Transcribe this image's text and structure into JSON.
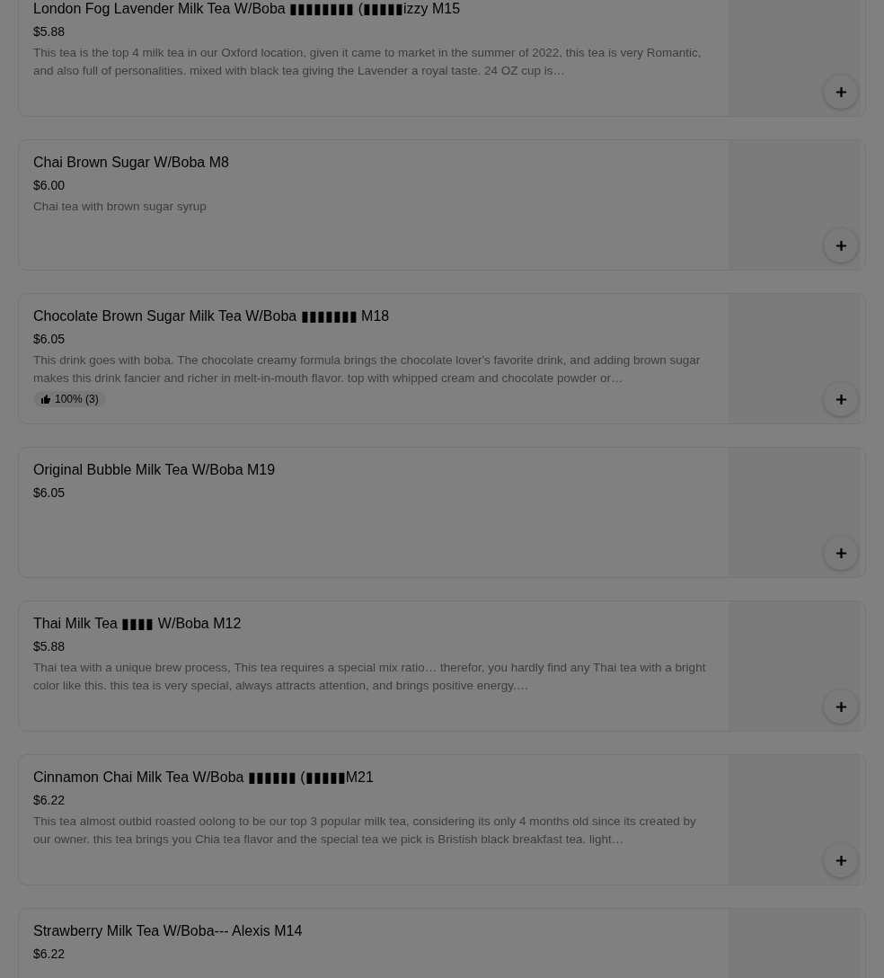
{
  "menu_items": [
    {
      "title": "London Fog Lavender Milk Tea W/Boba ▮▮▮▮▮▮▮▮ (▮▮▮▮▮izzy M15",
      "price": "$5.88",
      "description": "This tea is the top 4 milk tea in our Oxford location, given it came to market in the summer of 2022, this tea is very Romantic, and also full of personalities. mixed with black tea giving the Lavender a royal taste. 24 OZ cup is…"
    },
    {
      "title": "Chai Brown Sugar W/Boba M8",
      "price": "$6.00",
      "description": "Chai tea with brown sugar syrup"
    },
    {
      "title": "Chocolate Brown Sugar Milk Tea W/Boba ▮▮▮▮▮▮▮ M18",
      "price": "$6.05",
      "description": "This drink goes with boba. The chocolate creamy formula brings the chocolate lover's favorite drink, and adding brown sugar makes this drink fancier and richer in melt-in-mouth flavor. top with whipped cream and chocolate powder or…",
      "rating": "100% (3)"
    },
    {
      "title": "Original Bubble Milk Tea W/Boba M19",
      "price": "$6.05"
    },
    {
      "title": "Thai Milk Tea ▮▮▮▮ W/Boba M12",
      "price": "$5.88",
      "description": "Thai tea with a unique brew process, This tea requires a special mix ratio… therefor, you hardly find any Thai tea with a bright color like this. this tea is very special, always attracts attention, and brings positive energy.…"
    },
    {
      "title": "Cinnamon Chai Milk Tea W/Boba ▮▮▮▮▮▮ (▮▮▮▮▮M21",
      "price": "$6.22",
      "description": "This tea almost outbid roasted oolong to be our top 3 popular milk tea, considering its only 4 months old since its created by our owner. this tea brings you Chia tea flavor and the special tea we pick is Bristish black breakfast tea. light…"
    },
    {
      "title": "Strawberry Milk Tea W/Boba--- Alexis M14",
      "price": "$6.22"
    }
  ]
}
